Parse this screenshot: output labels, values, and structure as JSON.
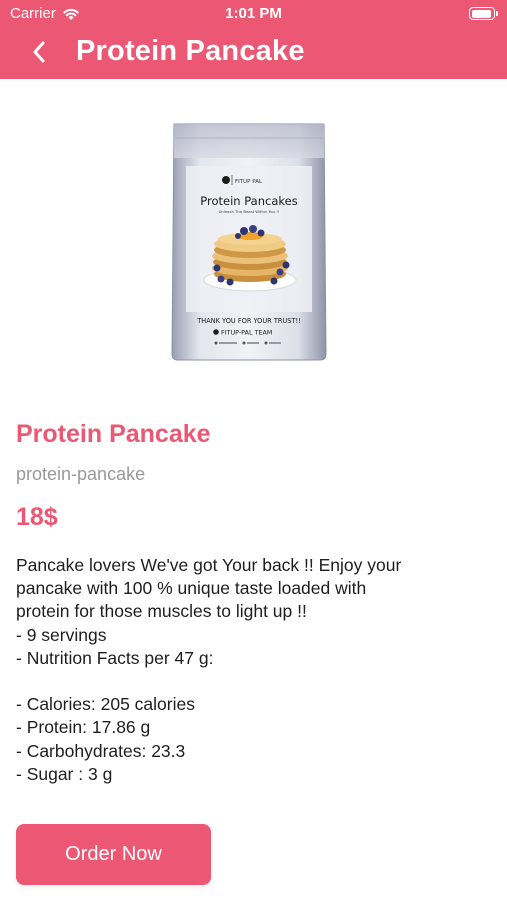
{
  "status_bar": {
    "carrier": "Carrier",
    "time": "1:01 PM",
    "wifi_icon": "wifi-icon",
    "battery_icon": "battery-icon"
  },
  "nav": {
    "back_icon": "chevron-left-icon",
    "title": "Protein Pancake"
  },
  "product": {
    "image": {
      "brand": "FITUP PAL",
      "heading": "Protein Pancakes",
      "tagline": "Unleash The Beast Within You !!",
      "footer_line": "THANK YOU FOR YOUR TRUST!!",
      "team": "FITUP-PAL TEAM"
    },
    "title": "Protein Pancake",
    "slug": "protein-pancake",
    "price": "18$",
    "description_lines": [
      "Pancake lovers We've got Your back !! Enjoy your",
      "pancake with 100 % unique taste loaded with",
      "protein for those muscles to light up !!",
      "- 9 servings",
      "- Nutrition Facts per 47 g:",
      "",
      "- Calories: 205 calories",
      "- Protein: 17.86 g",
      "- Carbohydrates: 23.3",
      "- Sugar : 3 g"
    ]
  },
  "order_button": {
    "label": "Order Now"
  },
  "colors": {
    "accent": "#ec5773",
    "text": "#1e1e1e",
    "muted": "#999999",
    "background": "#ffffff"
  }
}
